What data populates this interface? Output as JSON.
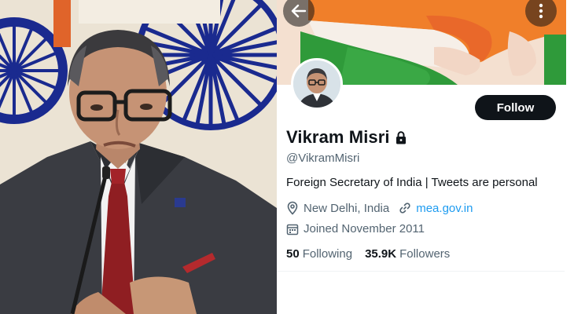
{
  "profile": {
    "name": "Vikram Misri",
    "handle": "@VikramMisri",
    "bio": "Foreign Secretary of India | Tweets are personal",
    "location": "New Delhi, India",
    "website": "mea.gov.in",
    "joined": "Joined November 2011",
    "following_count": "50",
    "following_label": "Following",
    "followers_count": "35.9K",
    "followers_label": "Followers",
    "follow_label": "Follow",
    "protected_icon": "lock-icon"
  },
  "icons": {
    "back": "arrow-left-icon",
    "more": "more-vertical-icon",
    "location": "map-pin-icon",
    "link": "link-icon",
    "calendar": "calendar-icon"
  },
  "colors": {
    "follow_button": "#0f1419",
    "link": "#1d9bf0",
    "secondary_text": "#536471",
    "saffron": "#f07f2a",
    "green": "#2f9a3a",
    "chakra_blue": "#1a2a8f"
  }
}
